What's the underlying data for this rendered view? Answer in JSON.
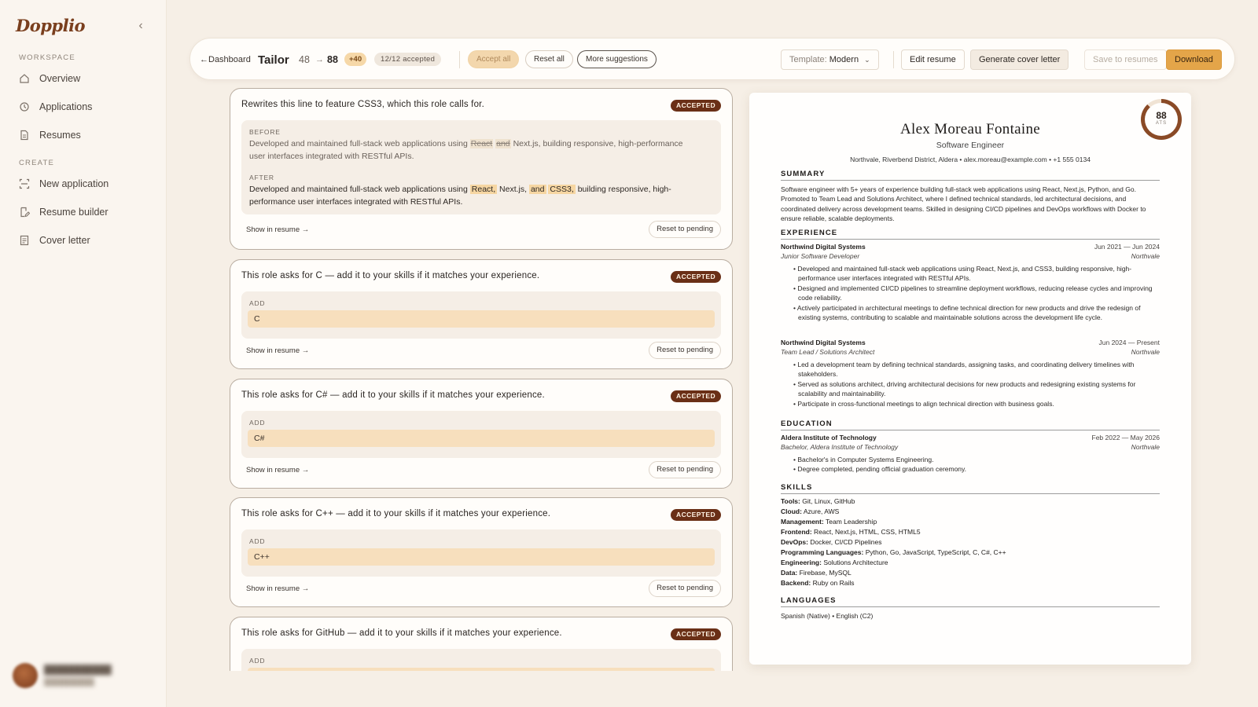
{
  "app": {
    "name": "Dopplio"
  },
  "sidebar": {
    "workspace_label": "WORKSPACE",
    "create_label": "CREATE",
    "workspace_items": [
      {
        "label": "Overview",
        "icon": "home-icon"
      },
      {
        "label": "Applications",
        "icon": "history-icon"
      },
      {
        "label": "Resumes",
        "icon": "document-icon"
      }
    ],
    "create_items": [
      {
        "label": "New application",
        "icon": "scan-icon"
      },
      {
        "label": "Resume builder",
        "icon": "edit-document-icon"
      },
      {
        "label": "Cover letter",
        "icon": "letter-icon"
      }
    ]
  },
  "toolbar": {
    "back": "←Dashboard",
    "title": "Tailor",
    "score_before": "48",
    "arrow": "→",
    "score_after": "88",
    "delta": "+40",
    "accepted": "12/12 accepted",
    "accept_all": "Accept all",
    "reset_all": "Reset all",
    "more_suggestions": "More suggestions",
    "template_label": "Template:",
    "template_value": "Modern",
    "edit_resume": "Edit resume",
    "generate_cover": "Generate cover letter",
    "save_to_resumes": "Save to resumes",
    "download": "Download"
  },
  "suggestions": [
    {
      "question": "Rewrites this line to feature CSS3, which this role calls for.",
      "status": "ACCEPTED",
      "before_label": "BEFORE",
      "before_pre": "Developed and maintained full-stack web applications using ",
      "before_removed_1": "React",
      "before_removed_2": "and",
      "before_post": " Next.js, building responsive, high-performance user interfaces integrated with RESTful APIs.",
      "after_label": "AFTER",
      "after_pre": "Developed and maintained full-stack web applications using ",
      "after_added_1": "React,",
      "after_mid": " Next.js, ",
      "after_added_2": "and",
      "after_added_3": "CSS3,",
      "after_post": " building responsive, high-performance user interfaces integrated with RESTful APIs.",
      "show_link": "Show in resume →",
      "reset": "Reset to pending"
    },
    {
      "question": "This role asks for C — add it to your skills if it matches your experience.",
      "status": "ACCEPTED",
      "add_label": "ADD",
      "value": "C",
      "show_link": "Show in resume →",
      "reset": "Reset to pending"
    },
    {
      "question": "This role asks for C# — add it to your skills if it matches your experience.",
      "status": "ACCEPTED",
      "add_label": "ADD",
      "value": "C#",
      "show_link": "Show in resume →",
      "reset": "Reset to pending"
    },
    {
      "question": "This role asks for C++ — add it to your skills if it matches your experience.",
      "status": "ACCEPTED",
      "add_label": "ADD",
      "value": "C++",
      "show_link": "Show in resume →",
      "reset": "Reset to pending"
    },
    {
      "question": "This role asks for GitHub — add it to your skills if it matches your experience.",
      "status": "ACCEPTED",
      "add_label": "ADD"
    }
  ],
  "resume": {
    "ats_score": "88",
    "ats_label": "ATS",
    "ats_fraction": 0.88,
    "name": "Alex Moreau Fontaine",
    "role": "Software Engineer",
    "contact": "Northvale, Riverbend District, Aldera • alex.moreau@example.com • +1 555 0134",
    "summary_title": "SUMMARY",
    "summary": "Software engineer with 5+ years of experience building full-stack web applications using React, Next.js, Python, and Go. Promoted to Team Lead and Solutions Architect, where I defined technical standards, led architectural decisions, and coordinated delivery across development teams. Skilled in designing CI/CD pipelines and DevOps workflows with Docker to ensure reliable, scalable deployments.",
    "experience_title": "EXPERIENCE",
    "exp1": {
      "company": "Northwind Digital Systems",
      "dates": "Jun 2021 — Jun 2024",
      "title": "Junior Software Developer",
      "location": "Northvale",
      "bullets": [
        "• Developed and maintained full-stack web applications using React, Next.js, and CSS3, building responsive, high-performance user interfaces integrated with RESTful APIs.",
        "• Designed and implemented CI/CD pipelines to streamline deployment workflows, reducing release cycles and improving code reliability.",
        "• Actively participated in architectural meetings to define technical direction for new products and drive the redesign of existing systems, contributing to scalable and maintainable solutions across the development life cycle."
      ]
    },
    "exp2": {
      "company": "Northwind Digital Systems",
      "dates": "Jun 2024 — Present",
      "title": "Team Lead / Solutions Architect",
      "location": "Northvale",
      "bullets": [
        "• Led a development team by defining technical standards, assigning tasks, and coordinating delivery timelines with stakeholders.",
        "• Served as solutions architect, driving architectural decisions for new products and redesigning existing systems for scalability and maintainability.",
        "• Participate in cross-functional meetings to align technical direction with business goals."
      ]
    },
    "education_title": "EDUCATION",
    "edu": {
      "school": "Aldera Institute of Technology",
      "dates": "Feb 2022 — May 2026",
      "degree": "Bachelor, Aldera Institute of Technology",
      "location": "Northvale",
      "bullets": [
        "• Bachelor's in Computer Systems Engineering.",
        "• Degree completed, pending official graduation ceremony."
      ]
    },
    "skills_title": "SKILLS",
    "skills": [
      {
        "k": "Tools:",
        "v": " Git, Linux, GitHub"
      },
      {
        "k": "Cloud:",
        "v": " Azure, AWS"
      },
      {
        "k": "Management:",
        "v": " Team Leadership"
      },
      {
        "k": "Frontend:",
        "v": " React, Next.js, HTML, CSS, HTML5"
      },
      {
        "k": "DevOps:",
        "v": " Docker, CI/CD Pipelines"
      },
      {
        "k": "Programming Languages:",
        "v": " Python, Go, JavaScript, TypeScript, C, C#, C++"
      },
      {
        "k": "Engineering:",
        "v": " Solutions Architecture"
      },
      {
        "k": "Data:",
        "v": " Firebase, MySQL"
      },
      {
        "k": "Backend:",
        "v": " Ruby on Rails"
      }
    ],
    "languages_title": "LANGUAGES",
    "languages": "Spanish (Native) • English (C2)"
  },
  "colors": {
    "accent": "#e4a549",
    "badge": "#6a2f16",
    "highlight": "#f6d6a2",
    "background": "#f6efe6"
  }
}
